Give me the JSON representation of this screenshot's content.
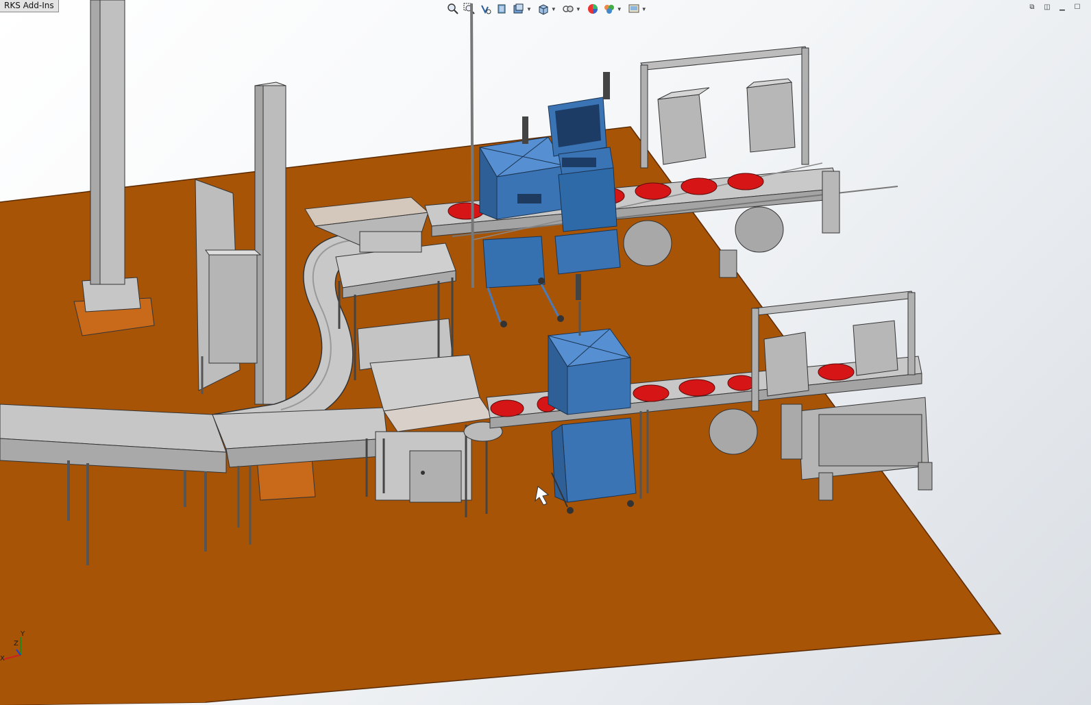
{
  "tab": {
    "label": "RKS Add-Ins"
  },
  "heads_up_toolbar": {
    "buttons": [
      {
        "name": "zoom-to-fit-icon",
        "has_dropdown": false
      },
      {
        "name": "zoom-to-area-icon",
        "has_dropdown": false
      },
      {
        "name": "previous-view-icon",
        "has_dropdown": false
      },
      {
        "name": "section-view-icon",
        "has_dropdown": false
      },
      {
        "name": "dynamic-annotation-icon",
        "has_dropdown": true
      },
      {
        "name": "view-orientation-icon",
        "has_dropdown": true
      },
      {
        "name": "display-style-icon",
        "has_dropdown": true
      },
      {
        "name": "hide-show-items-icon",
        "has_dropdown": true
      },
      {
        "name": "edit-appearance-icon",
        "has_dropdown": false
      },
      {
        "name": "apply-scene-icon",
        "has_dropdown": true
      },
      {
        "name": "view-settings-icon",
        "has_dropdown": true
      }
    ]
  },
  "window_controls": [
    "restore-viewport-icon",
    "tile-viewport-icon",
    "minimize-viewport-icon",
    "maximize-viewport-icon"
  ],
  "triad": {
    "y_label": "Y",
    "z_label": "Z",
    "x_label": "X"
  },
  "colors": {
    "floor": "#A85407",
    "floor_edge": "#7a3a05",
    "steel": "#c6c6c6",
    "steel_dark": "#9a9a9a",
    "blue_cabinet": "#3a74b5",
    "blue_dark": "#24527f",
    "red_product": "#d61616",
    "copper": "#c96a1a"
  }
}
